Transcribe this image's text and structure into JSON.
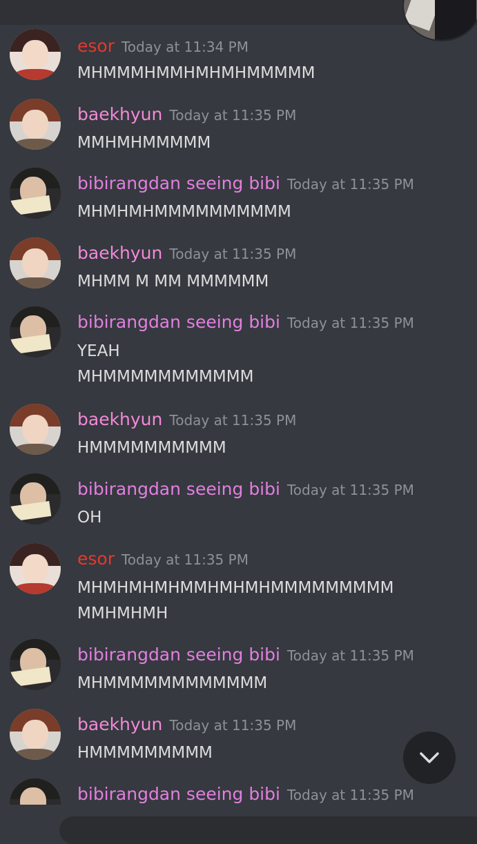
{
  "topbar": {
    "title_fragment": ""
  },
  "colors": {
    "esor": "#e8372c",
    "baekhyun": "#f289d8",
    "bibi": "#e27fe0"
  },
  "messages": [
    {
      "author": "esor",
      "timestamp": "Today at 11:34 PM",
      "lines": [
        "MHMMMHMMHMHMHMMMMM"
      ],
      "avatar": "esor"
    },
    {
      "author": "baekhyun",
      "timestamp": "Today at 11:35 PM",
      "lines": [
        "MMHMHMMMMM"
      ],
      "avatar": "baekhyun"
    },
    {
      "author": "bibirangdan seeing bibi",
      "timestamp": "Today at 11:35 PM",
      "lines": [
        "MHMHMHMMMMMMMMMM"
      ],
      "avatar": "bibi"
    },
    {
      "author": "baekhyun",
      "timestamp": "Today at 11:35 PM",
      "lines": [
        "MHMM M MM MMMMMM"
      ],
      "avatar": "baekhyun"
    },
    {
      "author": "bibirangdan seeing bibi",
      "timestamp": "Today at 11:35 PM",
      "lines": [
        "YEAH",
        "MHMMMMMMMMMMM"
      ],
      "avatar": "bibi"
    },
    {
      "author": "baekhyun",
      "timestamp": "Today at 11:35 PM",
      "lines": [
        "HMMMMMMMMMM"
      ],
      "avatar": "baekhyun"
    },
    {
      "author": "bibirangdan seeing bibi",
      "timestamp": "Today at 11:35 PM",
      "lines": [
        "OH"
      ],
      "avatar": "bibi"
    },
    {
      "author": "esor",
      "timestamp": "Today at 11:35 PM",
      "lines": [
        "MHMHMHMHMMHMHMHMMMMMMMMM",
        "MMHMHMH"
      ],
      "avatar": "esor"
    },
    {
      "author": "bibirangdan seeing bibi",
      "timestamp": "Today at 11:35 PM",
      "lines": [
        "MHMMMMMMMMMMMM"
      ],
      "avatar": "bibi"
    },
    {
      "author": "baekhyun",
      "timestamp": "Today at 11:35 PM",
      "lines": [
        "HMMMMMMMMM"
      ],
      "avatar": "baekhyun"
    },
    {
      "author": "bibirangdan seeing bibi",
      "timestamp": "Today at 11:35 PM",
      "lines": [],
      "avatar": "bibi"
    }
  ],
  "icons": {
    "scroll_down": "chevron-down-icon"
  }
}
